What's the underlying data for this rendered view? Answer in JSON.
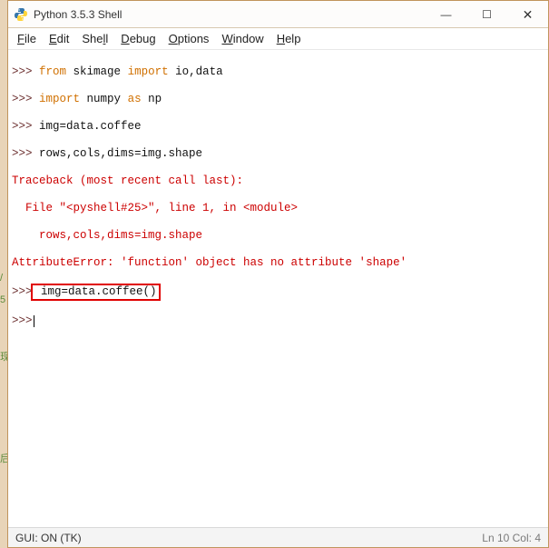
{
  "window": {
    "title": "Python 3.5.3 Shell"
  },
  "menu": {
    "file": "File",
    "edit": "Edit",
    "shell": "Shell",
    "debug": "Debug",
    "options": "Options",
    "window": "Window",
    "help": "Help"
  },
  "prompt": ">>>",
  "code": {
    "l1a": "from",
    "l1b": " skimage ",
    "l1c": "import",
    "l1d": " io,data",
    "l2a": "import",
    "l2b": " numpy ",
    "l2c": "as",
    "l2d": " np",
    "l3": " img=data.coffee",
    "l4": " rows,cols,dims=img.shape",
    "tb1": "Traceback (most recent call last):",
    "tb2": "  File \"<pyshell#25>\", line 1, in <module>",
    "tb3": "    rows,cols,dims=img.shape",
    "tb4": "AttributeError: 'function' object has no attribute 'shape'",
    "l5": " img=data.coffee()"
  },
  "status": {
    "left": "GUI: ON (TK)",
    "right": "Ln 10  Col: 4"
  },
  "icons": {
    "minimize": "—",
    "maximize": "☐",
    "close": "✕"
  }
}
